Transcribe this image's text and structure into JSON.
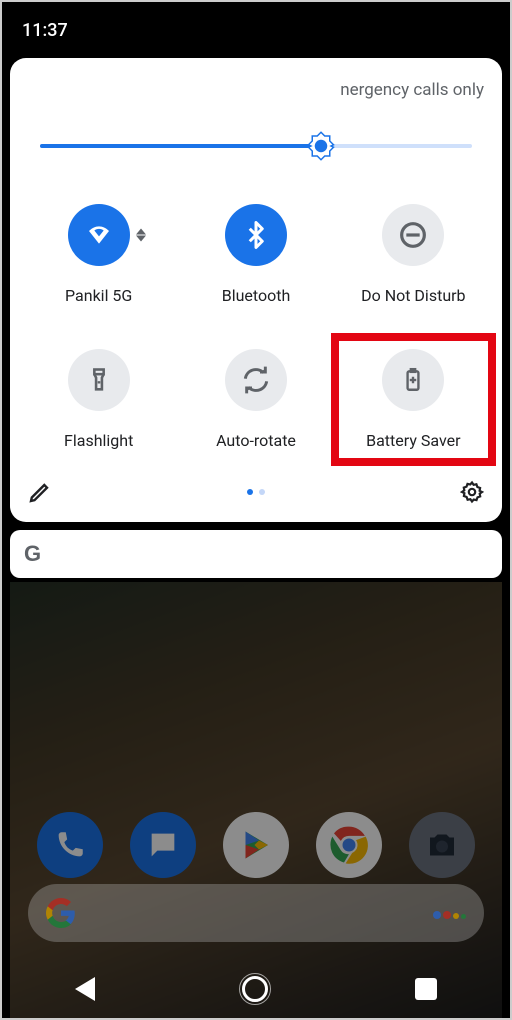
{
  "status": {
    "time": "11:37"
  },
  "header": {
    "network_status": "nergency calls only"
  },
  "brightness": {
    "value_pct": 65
  },
  "tiles": [
    {
      "id": "wifi",
      "label": "Pankil 5G",
      "icon": "wifi-icon",
      "active": true,
      "expandable": true
    },
    {
      "id": "bluetooth",
      "label": "Bluetooth",
      "icon": "bluetooth-icon",
      "active": true,
      "expandable": false
    },
    {
      "id": "dnd",
      "label": "Do Not Disturb",
      "icon": "dnd-icon",
      "active": false,
      "expandable": false
    },
    {
      "id": "flashlight",
      "label": "Flashlight",
      "icon": "flashlight-icon",
      "active": false,
      "expandable": false
    },
    {
      "id": "autorotate",
      "label": "Auto-rotate",
      "icon": "rotate-icon",
      "active": false,
      "expandable": false
    },
    {
      "id": "battery",
      "label": "Battery Saver",
      "icon": "battery-saver-icon",
      "active": false,
      "expandable": false,
      "highlighted": true
    }
  ],
  "pager": {
    "current": 0,
    "count": 2
  },
  "search": {
    "letter": "G"
  },
  "dock": [
    {
      "id": "phone",
      "name": "phone-app-icon"
    },
    {
      "id": "messages",
      "name": "messages-app-icon"
    },
    {
      "id": "play",
      "name": "play-store-app-icon"
    },
    {
      "id": "chrome",
      "name": "chrome-app-icon"
    },
    {
      "id": "camera",
      "name": "camera-app-icon"
    }
  ],
  "colors": {
    "accent": "#1a73e8",
    "inactive": "#e8eaed",
    "highlight": "#e30613"
  }
}
